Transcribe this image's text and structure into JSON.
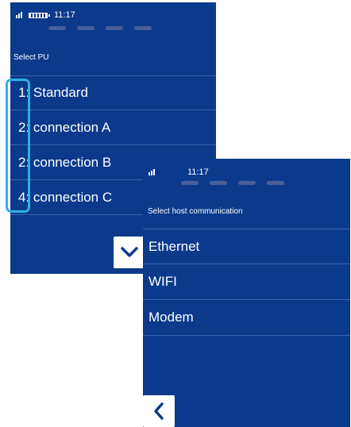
{
  "screen_a": {
    "status": {
      "time": "11:17",
      "icons": [
        "signal-icon",
        "battery-icon"
      ]
    },
    "prompt": "Select PU",
    "items": [
      {
        "label": "1: Standard"
      },
      {
        "label": "2: connection A"
      },
      {
        "label": "2: connection B"
      },
      {
        "label": "4: connection C"
      }
    ],
    "nav_button": {
      "icon": "chevron-down-icon"
    }
  },
  "screen_b": {
    "status": {
      "time": "11:17",
      "icons": [
        "signal-icon"
      ]
    },
    "prompt": "Select host communication",
    "items": [
      {
        "label": "Ethernet"
      },
      {
        "label": "WIFI"
      },
      {
        "label": "Modem"
      }
    ],
    "nav_button": {
      "icon": "chevron-left-icon"
    }
  },
  "colors": {
    "screen_background": "#0b3a8c",
    "divider": "#3d62ac",
    "highlight": "#2fb0e6"
  }
}
